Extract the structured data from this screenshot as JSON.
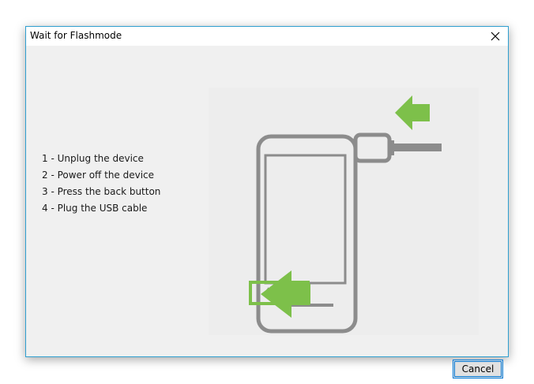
{
  "window": {
    "title": "Wait for Flashmode"
  },
  "instructions": {
    "steps": [
      "1 - Unplug the device",
      "2 - Power off the device",
      "3 - Press the back button",
      "4 - Plug the USB cable"
    ]
  },
  "buttons": {
    "cancel_label": "Cancel"
  },
  "icons": {
    "close": "close-icon",
    "arrow": "arrow-left-icon",
    "phone": "phone-icon",
    "usb": "usb-cable-icon",
    "back": "back-button-icon"
  },
  "colors": {
    "titlebar_border": "#2f9fd0",
    "accent_green": "#7dc04a",
    "device_gray": "#8c8c8c",
    "button_focus": "#0078d7"
  }
}
